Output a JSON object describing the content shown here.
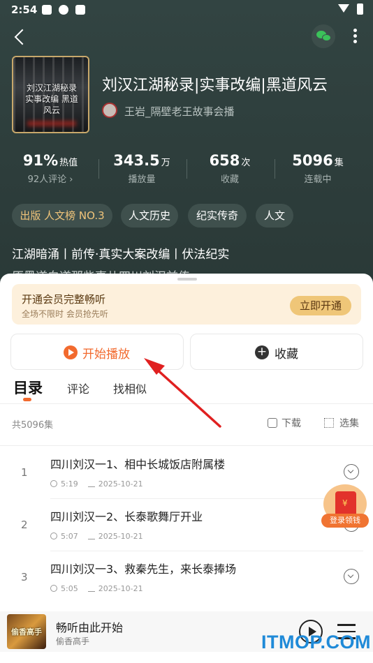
{
  "status_bar": {
    "time": "2:54"
  },
  "book": {
    "title": "刘汉江湖秘录|实事改编|黑道风云",
    "cover_text": "刘汉江湖秘录 实事改编 黑道风云",
    "author": "王岩_隔壁老王故事会播"
  },
  "stats": [
    {
      "value": "91%",
      "unit": "热值",
      "sub": "92人评论 ›"
    },
    {
      "value": "343.5",
      "unit": "万",
      "sub": "播放量"
    },
    {
      "value": "658",
      "unit": "次",
      "sub": "收藏"
    },
    {
      "value": "5096",
      "unit": "集",
      "sub": "连载中"
    }
  ],
  "tags": [
    "出版 人文榜 NO.3",
    "人文历史",
    "纪实传奇",
    "人文"
  ],
  "description": "江湖暗涌丨前传·真实大案改编丨伏法纪实",
  "description_line2": "原黑道白道那些事儿四川刘汉前传",
  "vip": {
    "title": "开通会员完整畅听",
    "subtitle": "全场不限时 会员抢先听",
    "button": "立即开通"
  },
  "actions": {
    "play": "开始播放",
    "favorite": "收藏"
  },
  "tabs": [
    "目录",
    "评论",
    "找相似"
  ],
  "list_header": {
    "count": "共5096集",
    "download": "下载",
    "select": "选集"
  },
  "episodes": [
    {
      "index": "1",
      "title": "四川刘汉一1、相中长城饭店附属楼",
      "duration": "5:19",
      "date": "2025-10-21"
    },
    {
      "index": "2",
      "title": "四川刘汉一2、长泰歌舞厅开业",
      "duration": "5:07",
      "date": "2025-10-21"
    },
    {
      "index": "3",
      "title": "四川刘汉一3、救秦先生，来长泰捧场",
      "duration": "5:05",
      "date": "2025-10-21"
    }
  ],
  "red_packet": {
    "label": "登录领钱"
  },
  "mini_player": {
    "cover_text": "偷香高手",
    "title": "畅听由此开始",
    "subtitle": "偷香高手"
  },
  "watermark": "ITMOP.COM",
  "colors": {
    "accent": "#f26a2e",
    "header_bg": "#2f403e",
    "vip_bg": "#fdf0dc",
    "arrow": "#e02020"
  }
}
